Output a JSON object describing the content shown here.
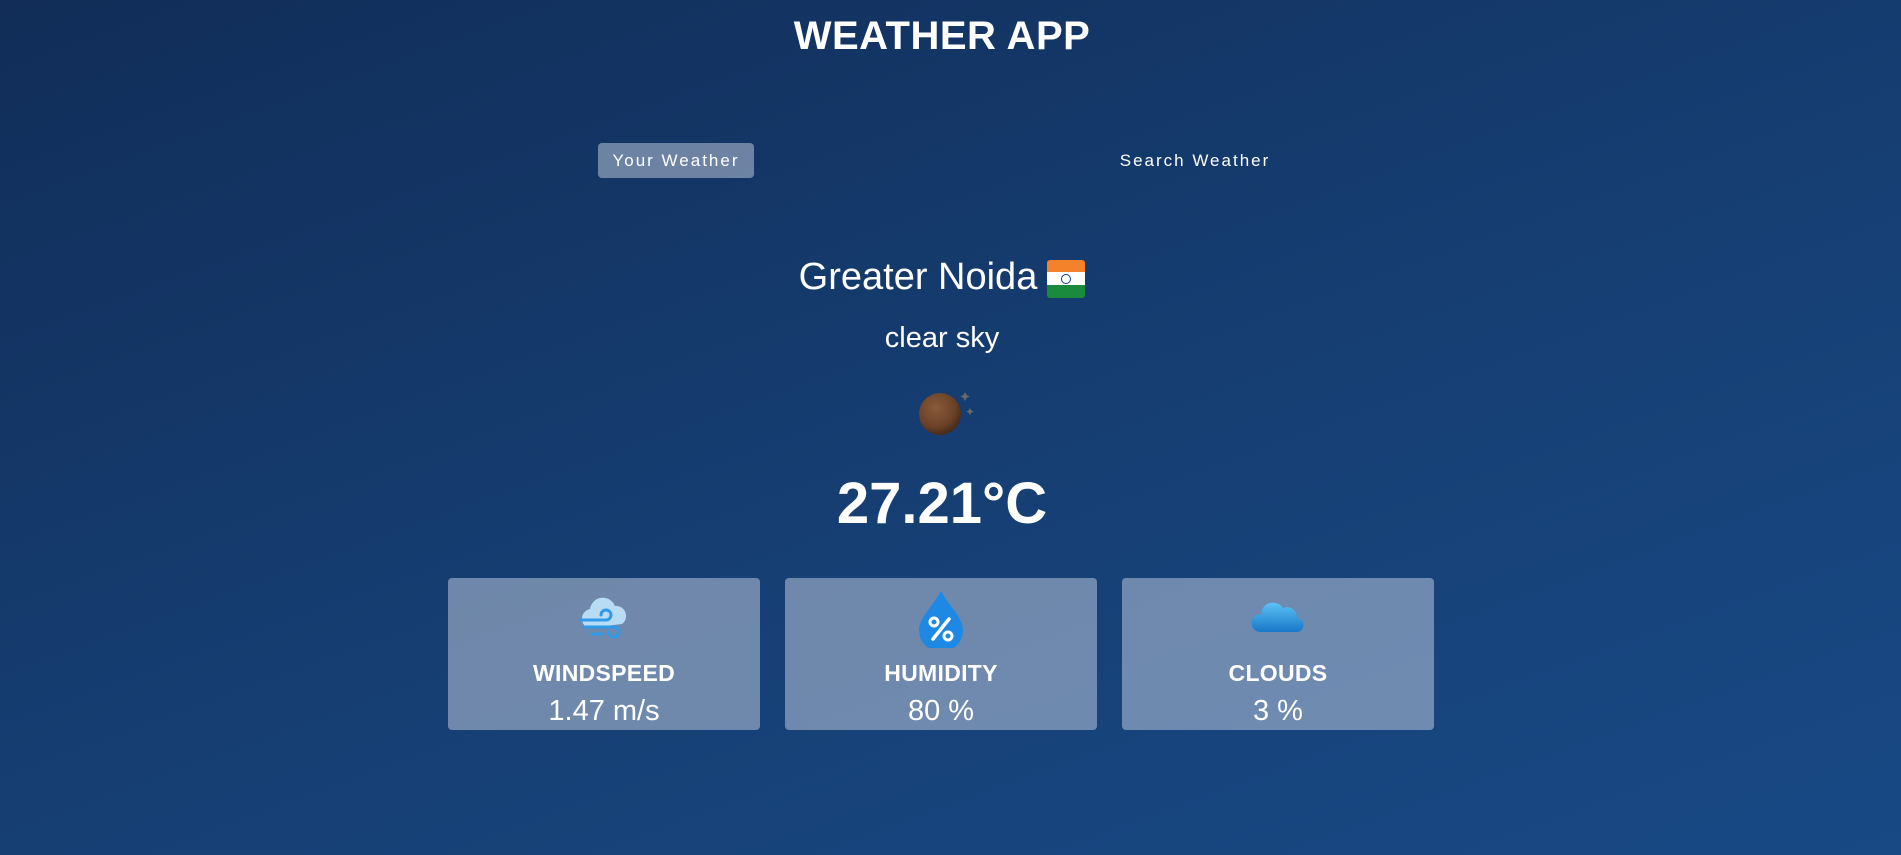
{
  "app": {
    "title": "WEATHER APP"
  },
  "tabs": [
    {
      "label": "Your Weather",
      "active": true
    },
    {
      "label": "Search Weather",
      "active": false
    }
  ],
  "weather": {
    "city": "Greater Noida",
    "country_flag_icon": "india-flag-icon",
    "description": "clear sky",
    "condition_icon": "clear-night-icon",
    "temperature": "27.21°C"
  },
  "cards": [
    {
      "label": "WINDSPEED",
      "value": "1.47 m/s",
      "icon": "wind-icon"
    },
    {
      "label": "HUMIDITY",
      "value": "80 %",
      "icon": "humidity-icon"
    },
    {
      "label": "CLOUDS",
      "value": "3 %",
      "icon": "cloud-icon"
    }
  ],
  "colors": {
    "background_top": "#112d58",
    "background_bottom": "#184985",
    "card_background": "rgba(219,226,239,0.45)",
    "accent_blue": "#2f9ae8"
  }
}
